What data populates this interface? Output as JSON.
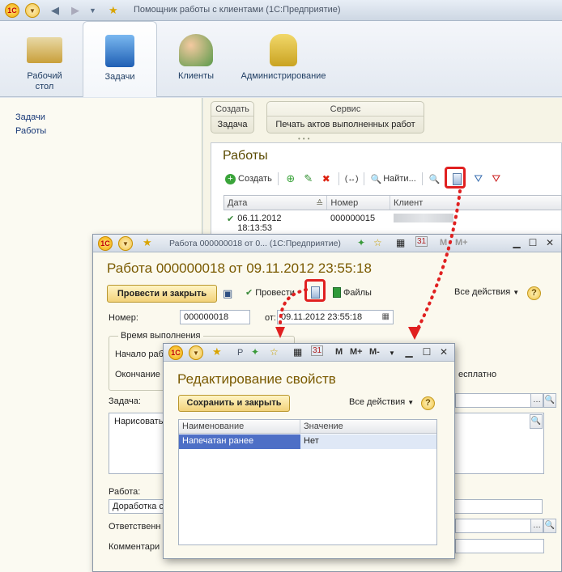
{
  "main": {
    "title": "Помощник работы с клиентами  (1С:Предприятие)",
    "sections": [
      {
        "label": "Рабочий\nстол"
      },
      {
        "label": "Задачи"
      },
      {
        "label": "Клиенты"
      },
      {
        "label": "Администрирование"
      }
    ],
    "left_nav": [
      "Задачи",
      "Работы"
    ],
    "cmd_groups": {
      "create": {
        "header": "Создать",
        "item": "Задача"
      },
      "service": {
        "header": "Сервис",
        "item": "Печать актов выполненных работ"
      }
    },
    "list": {
      "title": "Работы",
      "create_label": "Создать",
      "find_label": "Найти...",
      "columns": [
        "Дата",
        "Номер",
        "Клиент"
      ],
      "rows": [
        {
          "date": "06.11.2012\n18:13:53",
          "number": "000000015"
        }
      ]
    }
  },
  "window2": {
    "title": "Работа 000000018 от 0... (1С:Предприятие)",
    "heading": "Работа 000000018 от 09.11.2012 23:55:18",
    "post_close_label": "Провести и закрыть",
    "post_label": "Провести",
    "files_label": "Файлы",
    "all_actions_label": "Все действия",
    "number_label": "Номер:",
    "number_value": "000000018",
    "date_label": "от:",
    "date_value": "09.11.2012 23:55:18",
    "time_group_label": "Время выполнения",
    "start_label": "Начало рабо",
    "end_label": "Окончание",
    "free_label": "есплатно",
    "task_label": "Задача:",
    "task_text": "Нарисовать",
    "work_label": "Работа:",
    "work_value": "Доработка с",
    "responsible_label": "Ответственн",
    "comment_label": "Комментари"
  },
  "window3": {
    "title_short": "Р",
    "heading": "Редактирование свойств",
    "save_close_label": "Сохранить и закрыть",
    "all_actions_label": "Все действия",
    "columns": [
      "Наименование",
      "Значение"
    ],
    "rows": [
      {
        "name": "Напечатан ранее",
        "value": "Нет"
      }
    ]
  },
  "colors": {
    "highlight": "#e02020",
    "accent_gold": "#7a5a00",
    "selection": "#4d6fc6"
  }
}
